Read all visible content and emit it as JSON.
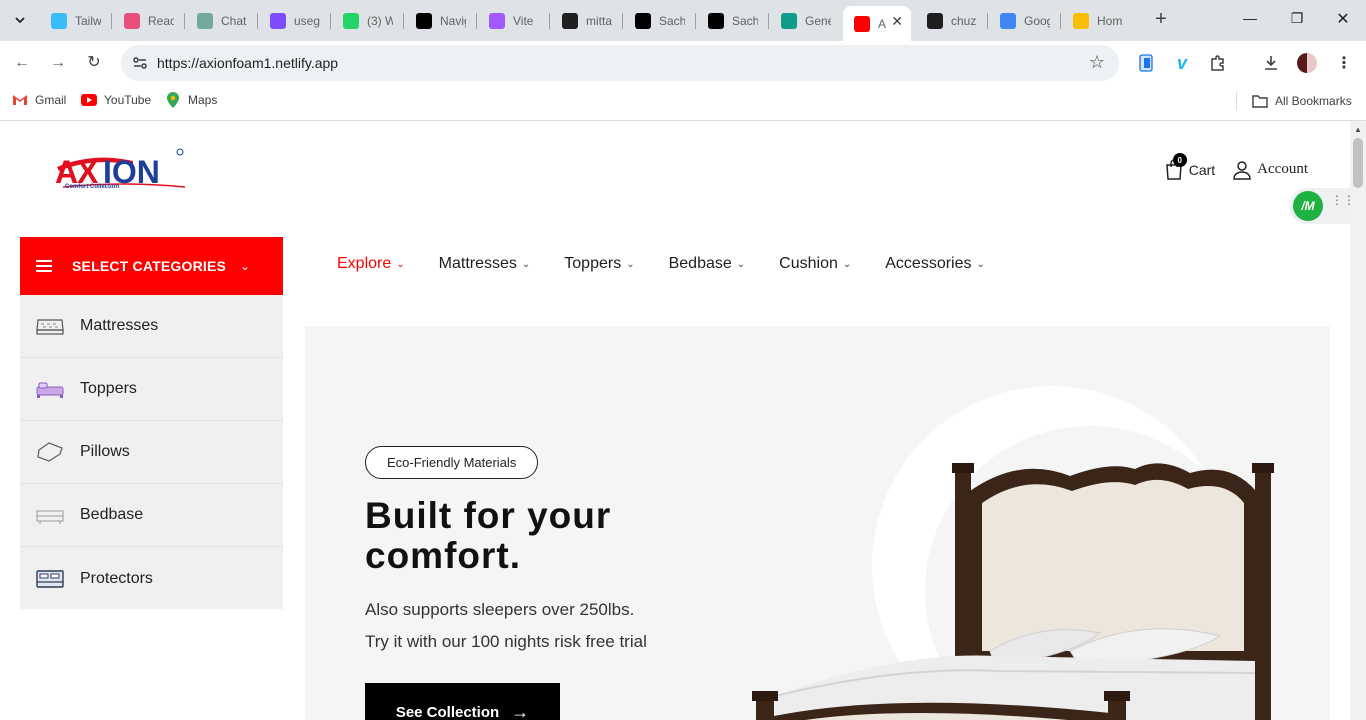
{
  "browser": {
    "tabs": [
      {
        "title": "Tailw",
        "icon": "tailwind-icon",
        "color": "#38bdf8"
      },
      {
        "title": "React",
        "icon": "react-icon",
        "color": "#e94f7c"
      },
      {
        "title": "Chat",
        "icon": "chatgpt-icon",
        "color": "#74aa9c"
      },
      {
        "title": "useg",
        "icon": "link-icon",
        "color": "#7c4dff"
      },
      {
        "title": "(3) W",
        "icon": "whatsapp-icon",
        "color": "#25d366"
      },
      {
        "title": "Navig",
        "icon": "navig-icon",
        "color": "#000000"
      },
      {
        "title": "Vite",
        "icon": "vite-icon",
        "color": "#a259ff"
      },
      {
        "title": "mitta",
        "icon": "github-icon",
        "color": "#1f1f1f"
      },
      {
        "title": "Sach",
        "icon": "sach-icon",
        "color": "#000000"
      },
      {
        "title": "Sach",
        "icon": "sach-icon",
        "color": "#000000"
      },
      {
        "title": "Gene",
        "icon": "gemini-icon",
        "color": "#0f9d8a"
      },
      {
        "title": "A",
        "icon": "axion-icon",
        "color": "#ff0000",
        "active": true
      },
      {
        "title": "chuz",
        "icon": "github-icon",
        "color": "#1f1f1f"
      },
      {
        "title": "Goog",
        "icon": "google-icon",
        "color": "#4285f4"
      },
      {
        "title": "Hom",
        "icon": "drive-icon",
        "color": "#fbbc04"
      }
    ],
    "url": "https://axionfoam1.netlify.app",
    "bookmarks": [
      {
        "label": "Gmail",
        "icon": "gmail-icon"
      },
      {
        "label": "YouTube",
        "icon": "youtube-icon"
      },
      {
        "label": "Maps",
        "icon": "maps-icon"
      }
    ],
    "all_bookmarks": "All Bookmarks"
  },
  "header": {
    "logo_text": "AXION",
    "logo_tagline": "Comfort Collection",
    "cart_label": "Cart",
    "cart_count": "0",
    "account_label": "Account",
    "extension_label": "M"
  },
  "categories": {
    "title": "SELECT CATEGORIES",
    "items": [
      {
        "label": "Mattresses",
        "icon": "mattress-icon"
      },
      {
        "label": "Toppers",
        "icon": "topper-icon"
      },
      {
        "label": "Pillows",
        "icon": "pillow-icon"
      },
      {
        "label": "Bedbase",
        "icon": "bedbase-icon"
      },
      {
        "label": "Protectors",
        "icon": "protector-icon"
      }
    ]
  },
  "nav": {
    "items": [
      {
        "label": "Explore",
        "active": true
      },
      {
        "label": "Mattresses"
      },
      {
        "label": "Toppers"
      },
      {
        "label": "Bedbase"
      },
      {
        "label": "Cushion"
      },
      {
        "label": "Accessories"
      }
    ]
  },
  "hero": {
    "badge": "Eco-Friendly Materials",
    "title": "Built for your comfort.",
    "subtitle_line1": "Also supports sleepers over 250lbs.",
    "subtitle_line2": "Try it with our 100 nights risk free trial",
    "button_label": "See Collection"
  },
  "colors": {
    "accent": "#ff0000",
    "button": "#000000",
    "hero_bg": "#f5f5f5",
    "sidebar_bg": "#f0f0f0"
  }
}
